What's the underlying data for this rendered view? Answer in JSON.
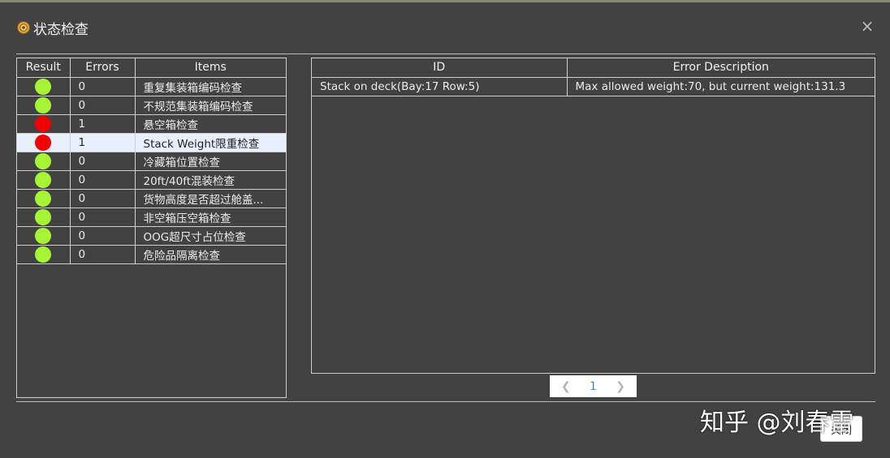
{
  "dialog": {
    "title": "状态检查"
  },
  "status_colors": {
    "ok": "#a6f534",
    "error": "#f40000"
  },
  "left_table": {
    "headers": [
      "Result",
      "Errors",
      "Items"
    ],
    "rows": [
      {
        "status": "ok",
        "errors": "0",
        "item": "重复集装箱编码检查"
      },
      {
        "status": "ok",
        "errors": "0",
        "item": "不规范集装箱编码检查"
      },
      {
        "status": "error",
        "errors": "1",
        "item": "悬空箱检查"
      },
      {
        "status": "error",
        "errors": "1",
        "item": "Stack Weight限重检查",
        "selected": true
      },
      {
        "status": "ok",
        "errors": "0",
        "item": "冷藏箱位置检查"
      },
      {
        "status": "ok",
        "errors": "0",
        "item": "20ft/40ft混装检查"
      },
      {
        "status": "ok",
        "errors": "0",
        "item": "货物高度是否超过舱盖..."
      },
      {
        "status": "ok",
        "errors": "0",
        "item": "非空箱压空箱检查"
      },
      {
        "status": "ok",
        "errors": "0",
        "item": "OOG超尺寸占位检查"
      },
      {
        "status": "ok",
        "errors": "0",
        "item": "危险品隔离检查"
      }
    ]
  },
  "right_table": {
    "headers": [
      "ID",
      "Error Description"
    ],
    "rows": [
      {
        "id": "Stack on deck(Bay:17 Row:5)",
        "description": "Max allowed weight:70, but current weight:131.3"
      }
    ]
  },
  "pagination": {
    "prev_icon": "chevron-left-icon",
    "current_page": "1",
    "next_icon": "chevron-right-icon"
  },
  "footer": {
    "close_label": "关闭",
    "watermark": "知乎 @刘春雷"
  }
}
